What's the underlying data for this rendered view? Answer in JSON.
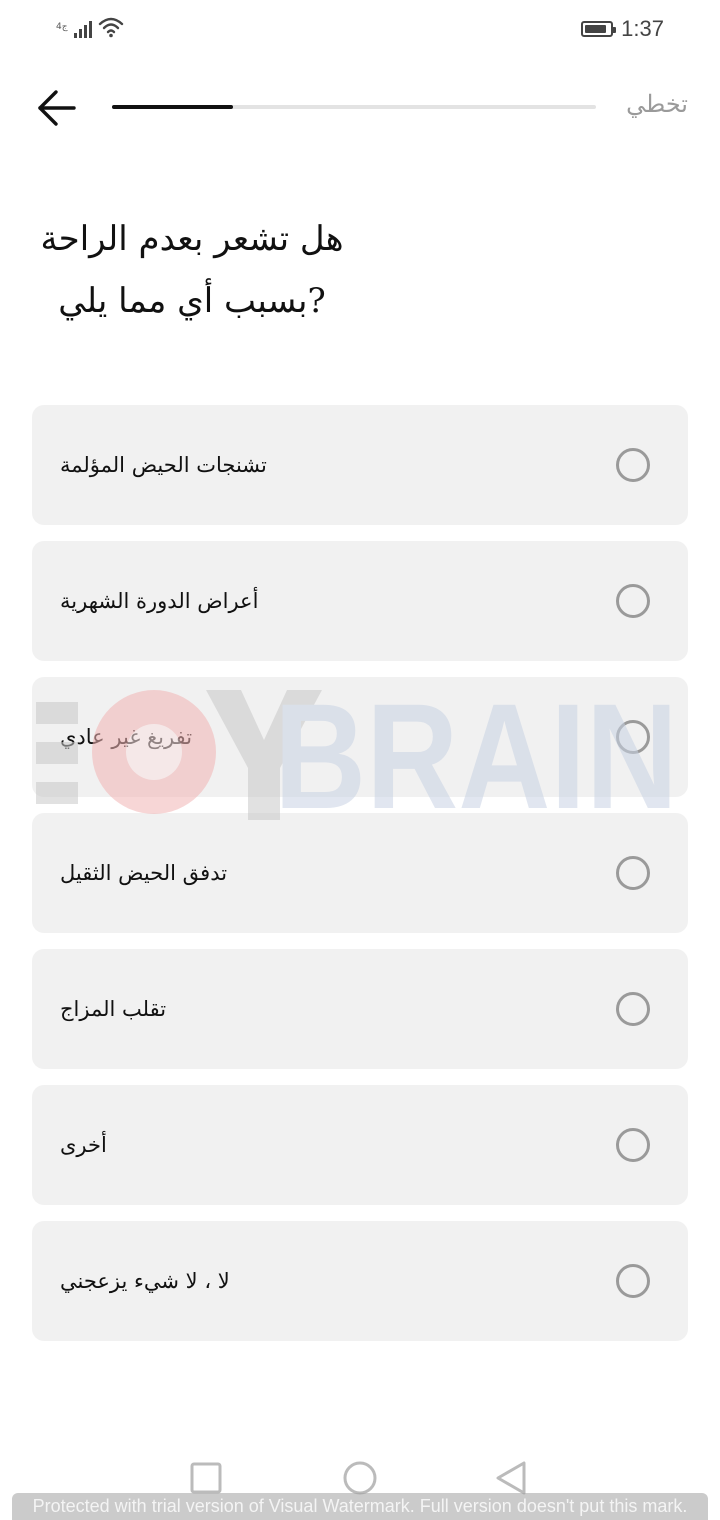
{
  "status_bar": {
    "sim_label": "4ج",
    "time": "1:37",
    "battery_level": 0.9,
    "icons": [
      "signal-icon",
      "wifi-icon",
      "battery-icon"
    ]
  },
  "header": {
    "back_icon": "arrow-left-icon",
    "progress": 0.25,
    "skip_label": "تخطي"
  },
  "question": {
    "line1": "هل تشعر بعدم الراحة",
    "line2": "?بسبب أي مما يلي"
  },
  "options": [
    {
      "label": "تشنجات الحيض المؤلمة",
      "selected": false
    },
    {
      "label": "أعراض الدورة الشهرية",
      "selected": false
    },
    {
      "label": "تفريغ غير عادي",
      "selected": false
    },
    {
      "label": "تدفق الحيض الثقيل",
      "selected": false
    },
    {
      "label": "تقلب المزاج",
      "selected": false
    },
    {
      "label": "أخرى",
      "selected": false
    },
    {
      "label": "لا ، لا شيء يزعجني",
      "selected": false
    }
  ],
  "nav_bar": {
    "icons": [
      "recent-apps-icon",
      "home-icon",
      "back-triangle-icon"
    ]
  },
  "watermark": {
    "logo_text": "BRAIN",
    "banner_text": "Protected with trial version of Visual Watermark. Full version doesn't put this mark."
  },
  "colors": {
    "option_background": "#f1f1f1",
    "radio_border": "#9a9a9a",
    "progress_fill": "#111111",
    "progress_track": "#e3e3e3",
    "skip_text": "#9a9a9a"
  }
}
